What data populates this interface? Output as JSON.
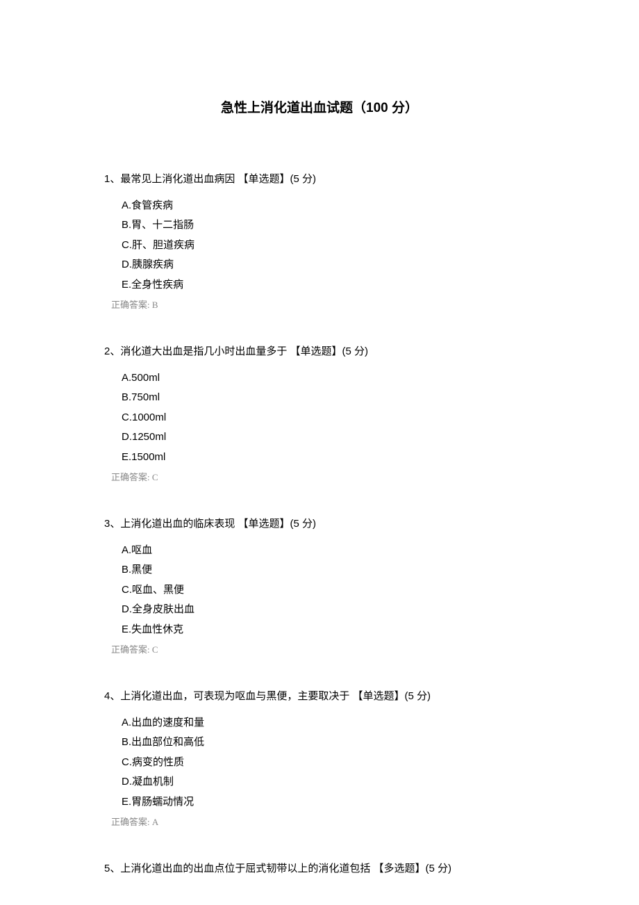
{
  "title": "急性上消化道出血试题（100 分）",
  "answer_label": "正确答案: ",
  "questions": [
    {
      "number": "1、",
      "text": "最常见上消化道出血病因 ",
      "type": "【单选题】",
      "points": "(5 分)",
      "options": [
        "A.食管疾病",
        "B.胃、十二指肠",
        "C.肝、胆道疾病",
        "D.胰腺疾病",
        "E.全身性疾病"
      ],
      "answer": "B"
    },
    {
      "number": "2、",
      "text": "消化道大出血是指几小时出血量多于 ",
      "type": "【单选题】",
      "points": "(5 分)",
      "options": [
        "A.500ml",
        "B.750ml",
        "C.1000ml",
        "D.1250ml",
        "E.1500ml"
      ],
      "answer": "C"
    },
    {
      "number": "3、",
      "text": "上消化道出血的临床表现 ",
      "type": "【单选题】",
      "points": "(5 分)",
      "options": [
        "A.呕血",
        "B.黑便",
        "C.呕血、黑便",
        "D.全身皮肤出血",
        "E.失血性休克"
      ],
      "answer": "C"
    },
    {
      "number": "4、",
      "text": "上消化道出血，可表现为呕血与黑便，主要取决于 ",
      "type": "【单选题】",
      "points": "(5 分)",
      "options": [
        "A.出血的速度和量",
        "B.出血部位和高低",
        "C.病变的性质",
        "D.凝血机制",
        "E.胃肠蠕动情况"
      ],
      "answer": "A"
    },
    {
      "number": "5、",
      "text": "上消化道出血的出血点位于屈式韧带以上的消化道包括 ",
      "type": "【多选题】",
      "points": "(5 分)",
      "options": [],
      "answer": ""
    }
  ]
}
